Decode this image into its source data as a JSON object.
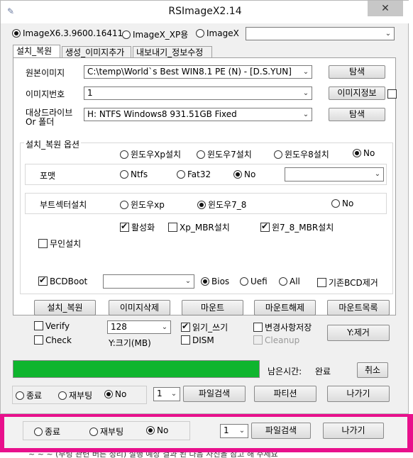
{
  "window": {
    "title": "RSImageX2.14",
    "close_glyph": "✕"
  },
  "mode": {
    "options": [
      {
        "label": "ImageX6.3.9600.16411",
        "selected": true
      },
      {
        "label": "ImageX_XP용",
        "selected": false
      },
      {
        "label": "ImageX",
        "selected": false
      }
    ],
    "imagex_path": ""
  },
  "tabs": [
    {
      "label": "설치_복원",
      "active": true
    },
    {
      "label": "생성_이미지추가",
      "active": false
    },
    {
      "label": "내보내기_정보수정",
      "active": false
    }
  ],
  "source": {
    "label": "원본이미지",
    "value": "C:\\temp\\World`s Best WIN8.1 PE  (N) - [D.S.YUN]",
    "browse": "탐색"
  },
  "image_index": {
    "label": "이미지번호",
    "value": "1",
    "info_button": "이미지정보"
  },
  "target": {
    "label1": "대상드라이브",
    "label2": "Or 폴더",
    "value": "H:  NTFS  Windows8   931.51GB  Fixed",
    "browse": "탐색"
  },
  "options": {
    "group_title": "설치_복원 옵션",
    "os_install": [
      {
        "label": "윈도우Xp설치",
        "selected": false
      },
      {
        "label": "윈도우7설치",
        "selected": false
      },
      {
        "label": "윈도우8설치",
        "selected": false
      },
      {
        "label": "No",
        "selected": true
      }
    ],
    "format": {
      "label": "포맷",
      "choices": [
        {
          "label": "Ntfs",
          "selected": false
        },
        {
          "label": "Fat32",
          "selected": false
        },
        {
          "label": "No",
          "selected": true
        }
      ],
      "drive": ""
    },
    "bootsector": {
      "label": "부트섹터설치",
      "choices": [
        {
          "label": "윈도우xp",
          "selected": false
        },
        {
          "label": "윈도우7_8",
          "selected": true
        },
        {
          "label": "No",
          "selected": false
        }
      ]
    },
    "activate": {
      "label": "활성화",
      "checked": true
    },
    "xp_mbr": {
      "label": "Xp_MBR설치",
      "checked": false
    },
    "win78_mbr": {
      "label": "윈7_8_MBR설치",
      "checked": true
    },
    "unattended": {
      "label": "무인설치",
      "checked": false
    },
    "bcdboot": {
      "label": "BCDBoot",
      "checked": true,
      "value": ""
    },
    "firmware": [
      {
        "label": "Bios",
        "selected": true
      },
      {
        "label": "Uefi",
        "selected": false
      },
      {
        "label": "All",
        "selected": false
      }
    ],
    "remove_bcd": {
      "label": "기존BCD제거",
      "checked": false
    }
  },
  "actions": {
    "install": "설치_복원",
    "delete_image": "이미지삭제",
    "mount": "마운트",
    "unmount": "마운트해제",
    "mount_list": "마운트목록"
  },
  "mount_opts": {
    "verify": {
      "label": "Verify",
      "checked": false
    },
    "check": {
      "label": "Check",
      "checked": false
    },
    "size_value": "128",
    "size_label": "Y:크기(MB)",
    "rw": {
      "label": "읽기_쓰기",
      "checked": true
    },
    "dism": {
      "label": "DISM",
      "checked": false
    },
    "save_changes": {
      "label": "변경사항저장",
      "checked": false
    },
    "cleanup": {
      "label": "Cleanup",
      "checked": false
    },
    "y_remove": "Y:제거"
  },
  "progress": {
    "fraction": 1.0,
    "color": "#0fb52e",
    "remaining_label": "남은시간:",
    "remaining_value": "완료",
    "cancel": "취소"
  },
  "footer": {
    "after": [
      {
        "label": "종료",
        "selected": false
      },
      {
        "label": "재부팅",
        "selected": false
      },
      {
        "label": "No",
        "selected": true
      }
    ],
    "count": "1",
    "file_search": "파일검색",
    "partition": "파티션",
    "exit": "나가기"
  },
  "shadow_footer": {
    "after": [
      {
        "label": "종료",
        "selected": false
      },
      {
        "label": "재부팅",
        "selected": false
      },
      {
        "label": "No",
        "selected": true
      }
    ],
    "count": "1",
    "file_search": "파일검색",
    "exit": "나가기",
    "caption": "~ ~ ~ (부팅 관련 버튼 정리) 실행 예상 결과 된 다음 사진을 참고 해 주세요"
  },
  "colors": {
    "highlight_frame": "#e8108c",
    "progress": "#0fb52e"
  }
}
